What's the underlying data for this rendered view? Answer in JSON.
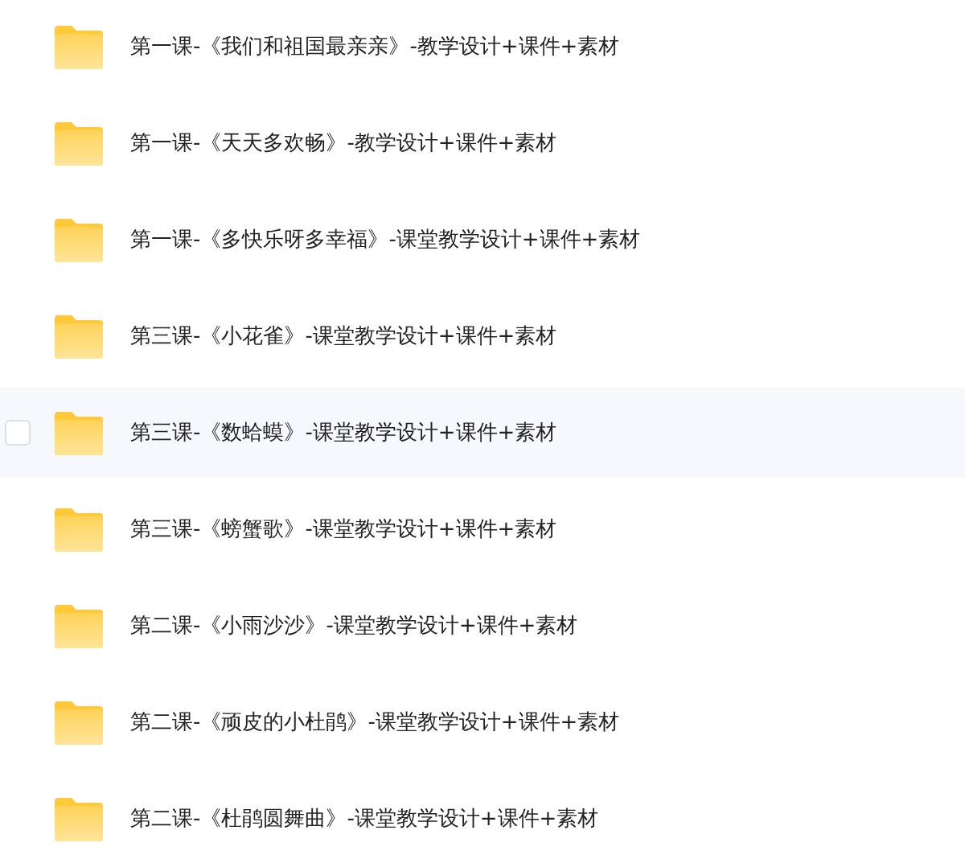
{
  "files": [
    {
      "name": "第一课-《我们和祖国最亲亲》-教学设计+课件+素材",
      "hovered": false,
      "checked": false
    },
    {
      "name": "第一课-《天天多欢畅》-教学设计+课件+素材",
      "hovered": false,
      "checked": false
    },
    {
      "name": "第一课-《多快乐呀多幸福》-课堂教学设计+课件+素材",
      "hovered": false,
      "checked": false
    },
    {
      "name": "第三课-《小花雀》-课堂教学设计+课件+素材",
      "hovered": false,
      "checked": false
    },
    {
      "name": "第三课-《数蛤蟆》-课堂教学设计+课件+素材",
      "hovered": true,
      "checked": false
    },
    {
      "name": "第三课-《螃蟹歌》-课堂教学设计+课件+素材",
      "hovered": false,
      "checked": false
    },
    {
      "name": "第二课-《小雨沙沙》-课堂教学设计+课件+素材",
      "hovered": false,
      "checked": false
    },
    {
      "name": "第二课-《顽皮的小杜鹃》-课堂教学设计+课件+素材",
      "hovered": false,
      "checked": false
    },
    {
      "name": "第二课-《杜鹃圆舞曲》-课堂教学设计+课件+素材",
      "hovered": false,
      "checked": false
    }
  ]
}
